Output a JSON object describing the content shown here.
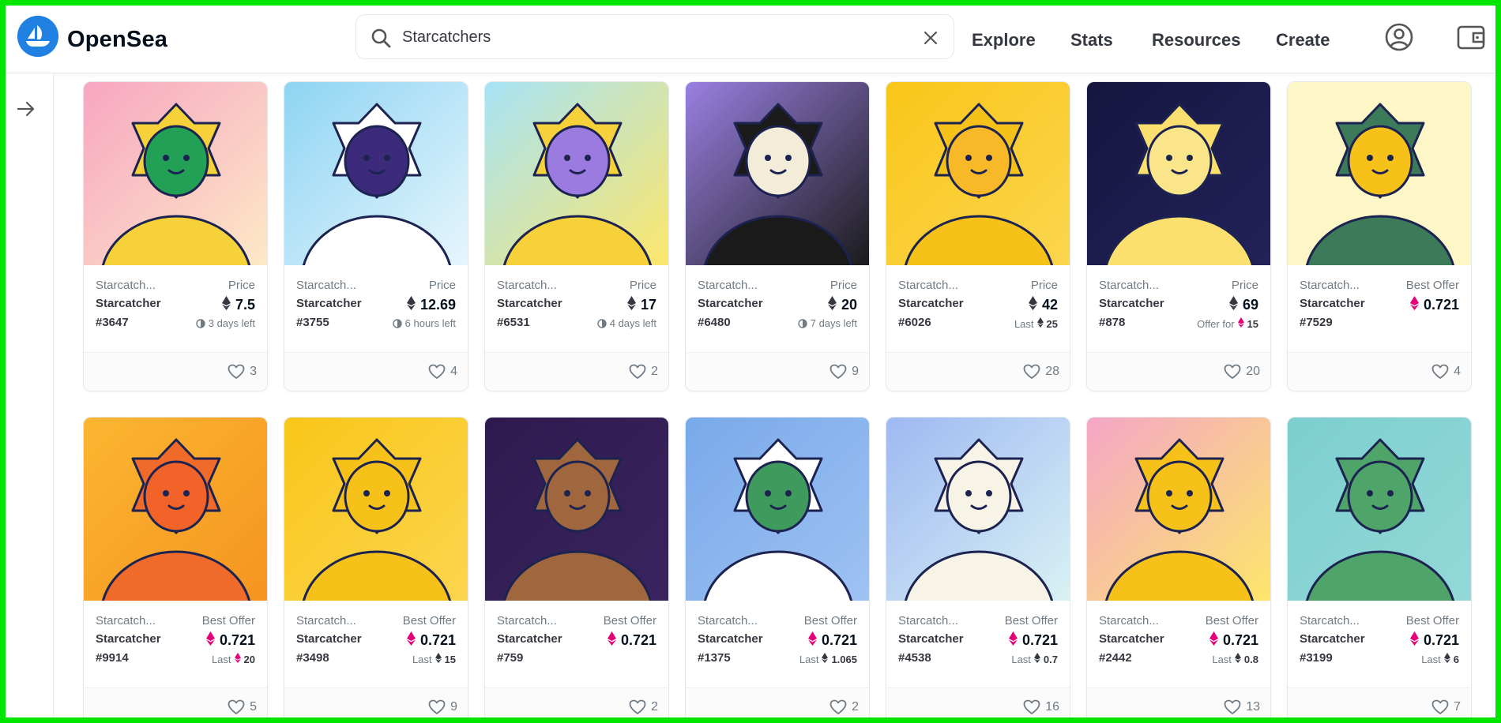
{
  "app": {
    "brand": "OpenSea"
  },
  "search": {
    "value": "Starcatchers"
  },
  "nav": {
    "explore": "Explore",
    "stats": "Stats",
    "resources": "Resources",
    "create": "Create"
  },
  "colors": {
    "accent": "#2081e2",
    "eth_pink": "#e5007a",
    "eth_dark": "#353840"
  },
  "cards": [
    {
      "collection": "Starcatch...",
      "name": "Starcatcher",
      "number": "#3647",
      "price_label": "Price",
      "price": "7.5",
      "currency": "eth",
      "sub_prefix": "",
      "sub_value": "3 days left",
      "sub_type": "time",
      "likes": "3",
      "bg": "#f7a6c2",
      "bg2": "#fde9c6",
      "char": "#22a055",
      "hood": "#f6d13a"
    },
    {
      "collection": "Starcatch...",
      "name": "Starcatcher",
      "number": "#3755",
      "price_label": "Price",
      "price": "12.69",
      "currency": "eth",
      "sub_prefix": "",
      "sub_value": "6 hours left",
      "sub_type": "time",
      "likes": "4",
      "bg": "#8ed4f2",
      "bg2": "#e7f6fd",
      "char": "#3c2a7a",
      "hood": "#ffffff"
    },
    {
      "collection": "Starcatch...",
      "name": "Starcatcher",
      "number": "#6531",
      "price_label": "Price",
      "price": "17",
      "currency": "eth",
      "sub_prefix": "",
      "sub_value": "4 days left",
      "sub_type": "time",
      "likes": "2",
      "bg": "#a6e3f7",
      "bg2": "#fde66a",
      "char": "#9b7be0",
      "hood": "#f6d13a"
    },
    {
      "collection": "Starcatch...",
      "name": "Starcatcher",
      "number": "#6480",
      "price_label": "Price",
      "price": "20",
      "currency": "eth",
      "sub_prefix": "",
      "sub_value": "7 days left",
      "sub_type": "time",
      "likes": "9",
      "bg": "#9a80e2",
      "bg2": "#1a1a1a",
      "char": "#f2ecd9",
      "hood": "#1a1a1a"
    },
    {
      "collection": "Starcatch...",
      "name": "Starcatcher",
      "number": "#6026",
      "price_label": "Price",
      "price": "42",
      "currency": "eth",
      "sub_prefix": "Last",
      "sub_value": "25",
      "sub_type": "eth",
      "likes": "28",
      "bg": "#f9c619",
      "bg2": "#fbd54e",
      "char": "#f7b928",
      "hood": "#f6c21a"
    },
    {
      "collection": "Starcatch...",
      "name": "Starcatcher",
      "number": "#878",
      "price_label": "Price",
      "price": "69",
      "currency": "eth",
      "sub_prefix": "Offer for",
      "sub_value": "15",
      "sub_type": "weth",
      "likes": "20",
      "bg": "#161640",
      "bg2": "#22225a",
      "char": "#fbe58a",
      "hood": "#fbe070"
    },
    {
      "collection": "Starcatch...",
      "name": "Starcatcher",
      "number": "#7529",
      "price_label": "Best Offer",
      "price": "0.721",
      "currency": "weth",
      "sub_prefix": "",
      "sub_value": "",
      "sub_type": "none",
      "likes": "4",
      "bg": "#fdf7c7",
      "bg2": "#fdf7c7",
      "char": "#f6c21a",
      "hood": "#3c7a5a"
    },
    {
      "collection": "Starcatch...",
      "name": "Starcatcher",
      "number": "#9914",
      "price_label": "Best Offer",
      "price": "0.721",
      "currency": "weth",
      "sub_prefix": "Last",
      "sub_value": "20",
      "sub_type": "weth",
      "likes": "5",
      "bg": "#fbb631",
      "bg2": "#f59420",
      "char": "#f2632a",
      "hood": "#f06a2a"
    },
    {
      "collection": "Starcatch...",
      "name": "Starcatcher",
      "number": "#3498",
      "price_label": "Best Offer",
      "price": "0.721",
      "currency": "weth",
      "sub_prefix": "Last",
      "sub_value": "15",
      "sub_type": "eth",
      "likes": "9",
      "bg": "#f9c619",
      "bg2": "#fbd54e",
      "char": "#f6c21a",
      "hood": "#f6c21a"
    },
    {
      "collection": "Starcatch...",
      "name": "Starcatcher",
      "number": "#759",
      "price_label": "Best Offer",
      "price": "0.721",
      "currency": "weth",
      "sub_prefix": "",
      "sub_value": "",
      "sub_type": "none",
      "likes": "2",
      "bg": "#2e1a4e",
      "bg2": "#3a2460",
      "char": "#a0663e",
      "hood": "#a0663e"
    },
    {
      "collection": "Starcatch...",
      "name": "Starcatcher",
      "number": "#1375",
      "price_label": "Best Offer",
      "price": "0.721",
      "currency": "weth",
      "sub_prefix": "Last",
      "sub_value": "1.065",
      "sub_type": "eth",
      "likes": "2",
      "bg": "#79a9ea",
      "bg2": "#9ec2f2",
      "char": "#3f9a5e",
      "hood": "#ffffff"
    },
    {
      "collection": "Starcatch...",
      "name": "Starcatcher",
      "number": "#4538",
      "price_label": "Best Offer",
      "price": "0.721",
      "currency": "weth",
      "sub_prefix": "Last",
      "sub_value": "0.7",
      "sub_type": "eth",
      "likes": "16",
      "bg": "#9fb8f2",
      "bg2": "#d8f2f4",
      "char": "#f7f3e6",
      "hood": "#f7f3e6"
    },
    {
      "collection": "Starcatch...",
      "name": "Starcatcher",
      "number": "#2442",
      "price_label": "Best Offer",
      "price": "0.721",
      "currency": "weth",
      "sub_prefix": "Last",
      "sub_value": "0.8",
      "sub_type": "eth",
      "likes": "13",
      "bg": "#f4a6c6",
      "bg2": "#fde66a",
      "char": "#f6c21a",
      "hood": "#f6c21a"
    },
    {
      "collection": "Starcatch...",
      "name": "Starcatcher",
      "number": "#3199",
      "price_label": "Best Offer",
      "price": "0.721",
      "currency": "weth",
      "sub_prefix": "Last",
      "sub_value": "6",
      "sub_type": "eth",
      "likes": "7",
      "bg": "#7ccfcf",
      "bg2": "#94d8d8",
      "char": "#4fa46a",
      "hood": "#4fa46a"
    }
  ]
}
